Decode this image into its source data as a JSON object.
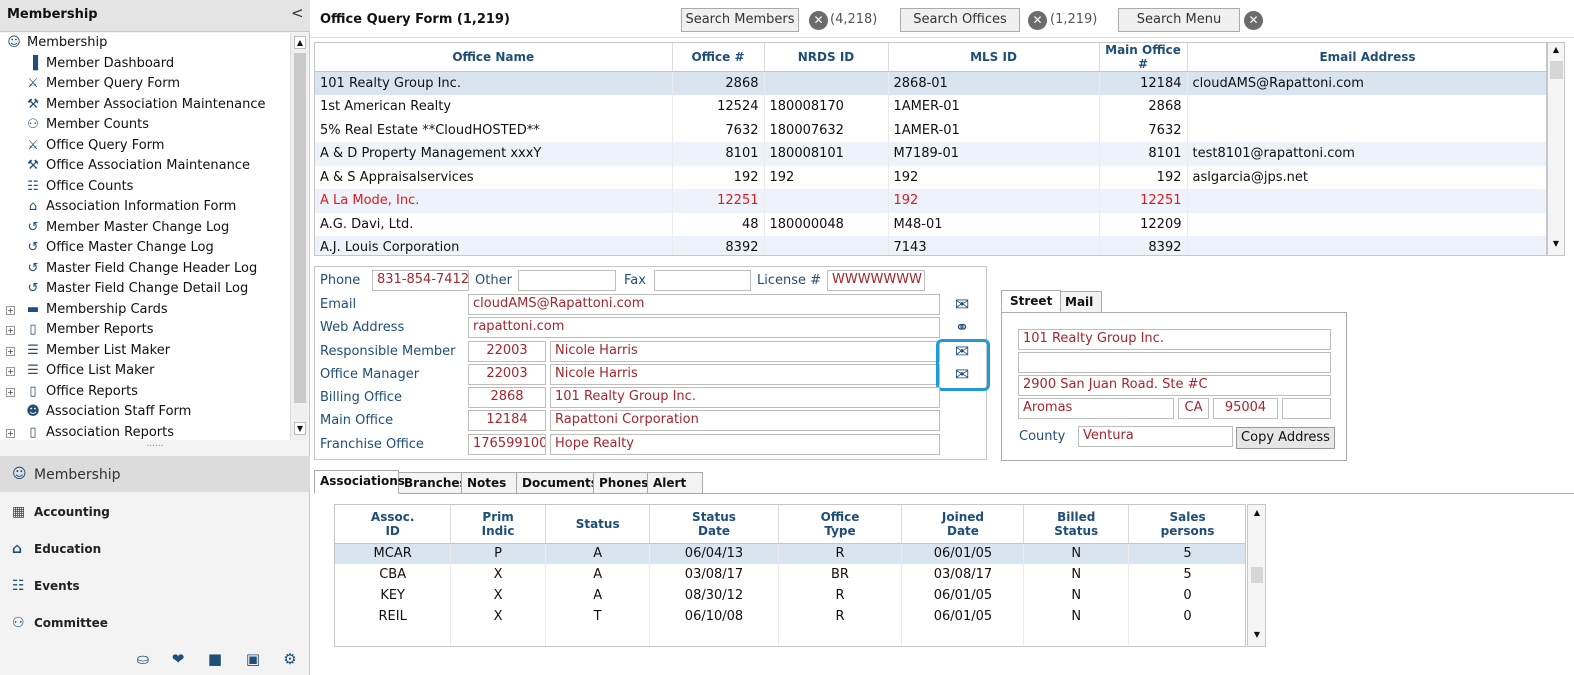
{
  "sidebar": {
    "title": "Membership",
    "collapse_glyph": "<",
    "tree": [
      {
        "label": "Membership",
        "icon": "membership-icon",
        "glyph": "☺",
        "expand": "",
        "level": 0
      },
      {
        "label": "Member Dashboard",
        "icon": "dashboard-icon",
        "glyph": "▐",
        "expand": "",
        "level": 1
      },
      {
        "label": "Member Query Form",
        "icon": "member-query-icon",
        "glyph": "⚔",
        "expand": "",
        "level": 1
      },
      {
        "label": "Member Association Maintenance",
        "icon": "member-assoc-icon",
        "glyph": "⚒",
        "expand": "",
        "level": 1
      },
      {
        "label": "Member Counts",
        "icon": "member-counts-icon",
        "glyph": "⚇",
        "expand": "",
        "level": 1
      },
      {
        "label": "Office Query Form",
        "icon": "office-query-icon",
        "glyph": "⚔",
        "expand": "",
        "level": 1
      },
      {
        "label": "Office Association Maintenance",
        "icon": "office-assoc-icon",
        "glyph": "⚒",
        "expand": "",
        "level": 1
      },
      {
        "label": "Office Counts",
        "icon": "office-counts-icon",
        "glyph": "☷",
        "expand": "",
        "level": 1
      },
      {
        "label": "Association Information Form",
        "icon": "association-building-icon",
        "glyph": "⌂",
        "expand": "",
        "level": 1
      },
      {
        "label": "Member Master Change Log",
        "icon": "change-log-icon",
        "glyph": "↺",
        "expand": "",
        "level": 1
      },
      {
        "label": "Office Master Change Log",
        "icon": "change-log-icon",
        "glyph": "↺",
        "expand": "",
        "level": 1
      },
      {
        "label": "Master Field Change Header Log",
        "icon": "change-log-icon",
        "glyph": "↺",
        "expand": "",
        "level": 1
      },
      {
        "label": "Master Field Change Detail Log",
        "icon": "change-log-icon",
        "glyph": "↺",
        "expand": "",
        "level": 1
      },
      {
        "label": "Membership Cards",
        "icon": "cards-icon",
        "glyph": "▬",
        "expand": "+",
        "level": 1
      },
      {
        "label": "Member Reports",
        "icon": "report-icon",
        "glyph": "▯",
        "expand": "+",
        "level": 1
      },
      {
        "label": "Member List Maker",
        "icon": "list-maker-icon",
        "glyph": "☰",
        "expand": "+",
        "level": 1
      },
      {
        "label": "Office List Maker",
        "icon": "list-maker-icon",
        "glyph": "☰",
        "expand": "+",
        "level": 1
      },
      {
        "label": "Office Reports",
        "icon": "report-icon",
        "glyph": "▯",
        "expand": "+",
        "level": 1
      },
      {
        "label": "Association Staff Form",
        "icon": "staff-form-icon",
        "glyph": "☻",
        "expand": "",
        "level": 1
      },
      {
        "label": "Association Reports",
        "icon": "report-icon",
        "glyph": "▯",
        "expand": "+",
        "level": 1
      }
    ],
    "grip": "......",
    "modules": [
      {
        "label": "Membership",
        "icon": "membership-icon",
        "glyph": "☺"
      },
      {
        "label": "Accounting",
        "icon": "accounting-icon",
        "glyph": "▦"
      },
      {
        "label": "Education",
        "icon": "education-icon",
        "glyph": "⌂"
      },
      {
        "label": "Events",
        "icon": "calendar-icon",
        "glyph": "☷"
      },
      {
        "label": "Committee",
        "icon": "committee-icon",
        "glyph": "⚇"
      }
    ],
    "bottom_icons": [
      {
        "icon": "database-icon",
        "glyph": "⛀"
      },
      {
        "icon": "handshake-icon",
        "glyph": "❤"
      },
      {
        "icon": "briefcase-icon",
        "glyph": "■"
      },
      {
        "icon": "portrait-icon",
        "glyph": "▣"
      },
      {
        "icon": "gear-icon",
        "glyph": "⚙"
      }
    ]
  },
  "header": {
    "title": "Office Query Form (1,219)",
    "search_members": {
      "label": "Search Members",
      "count": "(4,218)"
    },
    "search_offices": {
      "label": "Search Offices",
      "count": "(1,219)"
    },
    "search_menu": {
      "label": "Search Menu"
    },
    "close_glyph": "✕"
  },
  "office_table": {
    "columns": [
      "Office Name",
      "Office #",
      "NRDS ID",
      "MLS ID",
      "Main Office #",
      "Email Address"
    ],
    "rows": [
      {
        "name": "101 Realty Group Inc.",
        "office_no": "2868",
        "nrds": "",
        "mls": "2868-01",
        "main": "12184",
        "email": "cloudAMS@Rapattoni.com",
        "state": "sel"
      },
      {
        "name": "1st American Realty",
        "office_no": "12524",
        "nrds": "180008170",
        "mls": "1AMER-01",
        "main": "2868",
        "email": "",
        "state": ""
      },
      {
        "name": "5% Real Estate **CloudHOSTED**",
        "office_no": "7632",
        "nrds": "180007632",
        "mls": "1AMER-01",
        "main": "7632",
        "email": "",
        "state": ""
      },
      {
        "name": "A & D Property Management xxxY",
        "office_no": "8101",
        "nrds": "180008101",
        "mls": "M7189-01",
        "main": "8101",
        "email": "test8101@rapattoni.com",
        "state": "alt"
      },
      {
        "name": "A & S Appraisalservices",
        "office_no": "192",
        "nrds": "192",
        "mls": "192",
        "main": "192",
        "email": "aslgarcia@jps.net",
        "state": ""
      },
      {
        "name": "A La Mode, Inc.",
        "office_no": "12251",
        "nrds": "",
        "mls": "192",
        "main": "12251",
        "email": "",
        "state": "alt red"
      },
      {
        "name": "A.G. Davi, Ltd.",
        "office_no": "48",
        "nrds": "180000048",
        "mls": "M48-01",
        "main": "12209",
        "email": "",
        "state": ""
      },
      {
        "name": "A.J. Louis Corporation",
        "office_no": "8392",
        "nrds": "",
        "mls": "7143",
        "main": "8392",
        "email": "",
        "state": "alt"
      }
    ]
  },
  "details": {
    "phone_label": "Phone",
    "phone": "831-854-7412",
    "other_label": "Other",
    "other": "",
    "fax_label": "Fax",
    "fax": "",
    "license_label": "License #",
    "license": "WWWWWWW",
    "email_label": "Email",
    "email": "cloudAMS@Rapattoni.com",
    "web_label": "Web Address",
    "web": "rapattoni.com",
    "responsible_label": "Responsible Member",
    "responsible_id": "22003",
    "responsible_name": "Nicole Harris",
    "manager_label": "Office Manager",
    "manager_id": "22003",
    "manager_name": "Nicole Harris",
    "billing_label": "Billing Office",
    "billing_id": "2868",
    "billing_name": "101 Realty Group Inc.",
    "main_label": "Main Office",
    "main_id": "12184",
    "main_name": "Rapattoni Corporation",
    "franchise_label": "Franchise Office",
    "franchise_id": "176599100",
    "franchise_name": "Hope Realty",
    "email_glyph": "✉",
    "link_glyph": "⚭"
  },
  "address": {
    "tabs": [
      "Street",
      "Mail"
    ],
    "line1": "101 Realty Group Inc.",
    "line2": "",
    "line3": "2900 San Juan Road. Ste #C",
    "city": "Aromas",
    "state": "CA",
    "zip": "95004",
    "zip4": "",
    "county_label": "County",
    "county": "Ventura",
    "copy_label": "Copy Address"
  },
  "bottom_tabs": [
    "Associations",
    "Branches",
    "Notes",
    "Documents",
    "Phones",
    "Alert"
  ],
  "assoc_grid": {
    "headers": [
      [
        "Assoc.",
        "ID"
      ],
      [
        "Prim",
        "Indic"
      ],
      [
        "Status",
        ""
      ],
      [
        "Status",
        "Date"
      ],
      [
        "Office",
        "Type"
      ],
      [
        "Joined",
        "Date"
      ],
      [
        "Billed",
        "Status"
      ],
      [
        "Sales",
        "persons"
      ]
    ],
    "rows": [
      [
        "MCAR",
        "P",
        "A",
        "06/04/13",
        "R",
        "06/01/05",
        "N",
        "5"
      ],
      [
        "CBA",
        "X",
        "A",
        "03/08/17",
        "BR",
        "03/08/17",
        "N",
        "5"
      ],
      [
        "KEY",
        "X",
        "A",
        "08/30/12",
        "R",
        "06/01/05",
        "N",
        "0"
      ],
      [
        "REIL",
        "X",
        "T",
        "06/10/08",
        "R",
        "06/01/05",
        "N",
        "0"
      ]
    ]
  },
  "colors": {
    "label_blue": "#1f4e79",
    "value_red": "#a5262e",
    "highlight_blue": "#1e9ad6",
    "row_selected": "#d9e4f1"
  }
}
